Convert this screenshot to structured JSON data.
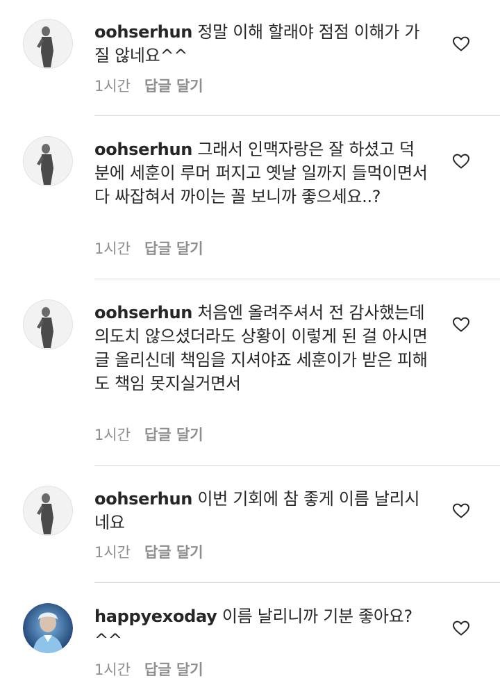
{
  "comments": [
    {
      "username": "oohserhun",
      "text": "정말 이해 할래야 점점 이해가 가질 않네요^^",
      "time": "1시간",
      "reply_label": "답글 달기",
      "avatar_icon": "profile-photo-bw",
      "like_icon": "heart-outline-icon"
    },
    {
      "username": "oohserhun",
      "text": "그래서 인맥자랑은 잘 하셨고 덕분에 세훈이 루머 퍼지고 옛날 일까지 들먹이면서 다 싸잡혀서 까이는 꼴 보니까 좋으세요..?",
      "time": "1시간",
      "reply_label": "답글 달기",
      "avatar_icon": "profile-photo-bw",
      "like_icon": "heart-outline-icon"
    },
    {
      "username": "oohserhun",
      "text": "처음엔 올려주셔서 전 감사했는데 의도치 않으셨더라도 상황이 이렇게 된 걸 아시면 글 올리신데 책임을 지셔야죠 세훈이가 받은 피해도 책임 못지실거면서",
      "time": "1시간",
      "reply_label": "답글 달기",
      "avatar_icon": "profile-photo-bw",
      "like_icon": "heart-outline-icon"
    },
    {
      "username": "oohserhun",
      "text": "이번 기회에 참 좋게 이름 날리시네요",
      "time": "1시간",
      "reply_label": "답글 달기",
      "avatar_icon": "profile-photo-bw",
      "like_icon": "heart-outline-icon"
    },
    {
      "username": "happyexoday",
      "text": "이름 날리니까 기분 좋아요?^^",
      "time": "1시간",
      "reply_label": "답글 달기",
      "avatar_icon": "profile-photo-color",
      "like_icon": "heart-outline-icon"
    }
  ],
  "colors": {
    "text": "#262626",
    "secondary": "#8e8e8e",
    "divider": "#dbdbdb"
  }
}
